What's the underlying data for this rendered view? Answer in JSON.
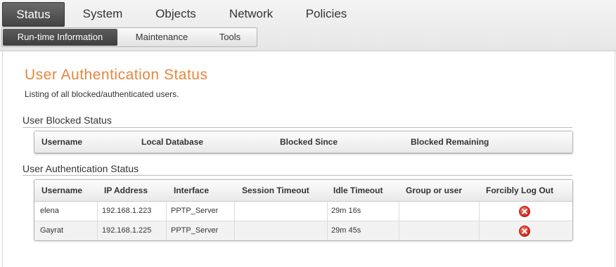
{
  "nav": {
    "main_tabs": [
      {
        "label": "Status",
        "active": true
      },
      {
        "label": "System",
        "active": false
      },
      {
        "label": "Objects",
        "active": false
      },
      {
        "label": "Network",
        "active": false
      },
      {
        "label": "Policies",
        "active": false
      }
    ],
    "sub_tabs": [
      {
        "label": "Run-time Information",
        "active": true
      },
      {
        "label": "Maintenance",
        "active": false
      },
      {
        "label": "Tools",
        "active": false
      }
    ]
  },
  "page": {
    "title": "User Authentication Status",
    "description": "Listing of all blocked/authenticated users."
  },
  "blocked": {
    "section_title": "User Blocked Status",
    "columns": [
      "Username",
      "Local Database",
      "Blocked Since",
      "Blocked Remaining"
    ],
    "rows": []
  },
  "auth": {
    "section_title": "User Authentication Status",
    "columns": [
      "Username",
      "IP Address",
      "Interface",
      "Session Timeout",
      "Idle Timeout",
      "Group or user",
      "Forcibly Log Out"
    ],
    "rows": [
      {
        "username": "elena",
        "ip": "192.168.1.223",
        "interface": "PPTP_Server",
        "session_timeout": "",
        "idle_timeout": "29m 16s",
        "group": "",
        "logout_icon": "close-circle-icon"
      },
      {
        "username": "Gayrat",
        "ip": "192.168.1.225",
        "interface": "PPTP_Server",
        "session_timeout": "",
        "idle_timeout": "29m 45s",
        "group": "",
        "logout_icon": "close-circle-icon"
      }
    ]
  },
  "colors": {
    "accent_title": "#e8853c",
    "active_tab": "#444444",
    "logout_red": "#d8261a"
  }
}
